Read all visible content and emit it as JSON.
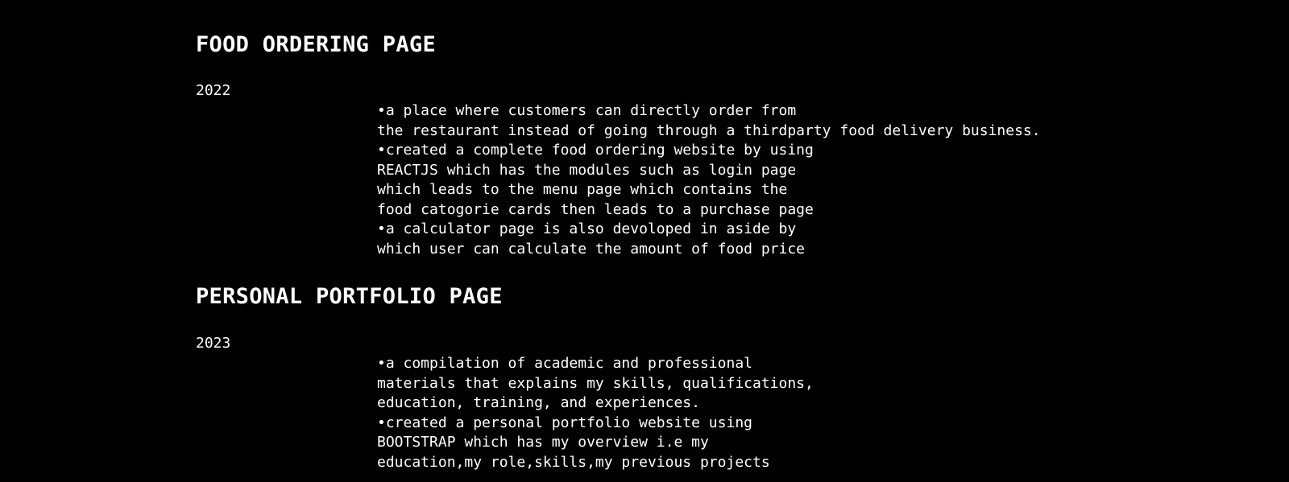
{
  "projects": [
    {
      "title": "FOOD ORDERING PAGE",
      "year": "2022",
      "lines": [
        "•a place where customers can directly order from",
        "the restaurant instead of going through a thirdparty food delivery business.",
        "•created a complete food ordering website by using",
        "REACTJS which has the modules such as login page",
        "which leads to the menu page which contains the",
        "food catogorie cards then leads to a purchase page",
        "•a calculator page is also devoloped in aside by",
        "which user can calculate the amount of food price"
      ]
    },
    {
      "title": "PERSONAL PORTFOLIO PAGE",
      "year": "2023",
      "lines": [
        "•a compilation of academic and professional",
        "materials that explains my skills, qualifications,",
        "education, training, and experiences.",
        "•created a personal portfolio website using",
        "BOOTSTRAP which has my overview i.e my",
        "education,my role,skills,my previous projects"
      ]
    }
  ]
}
